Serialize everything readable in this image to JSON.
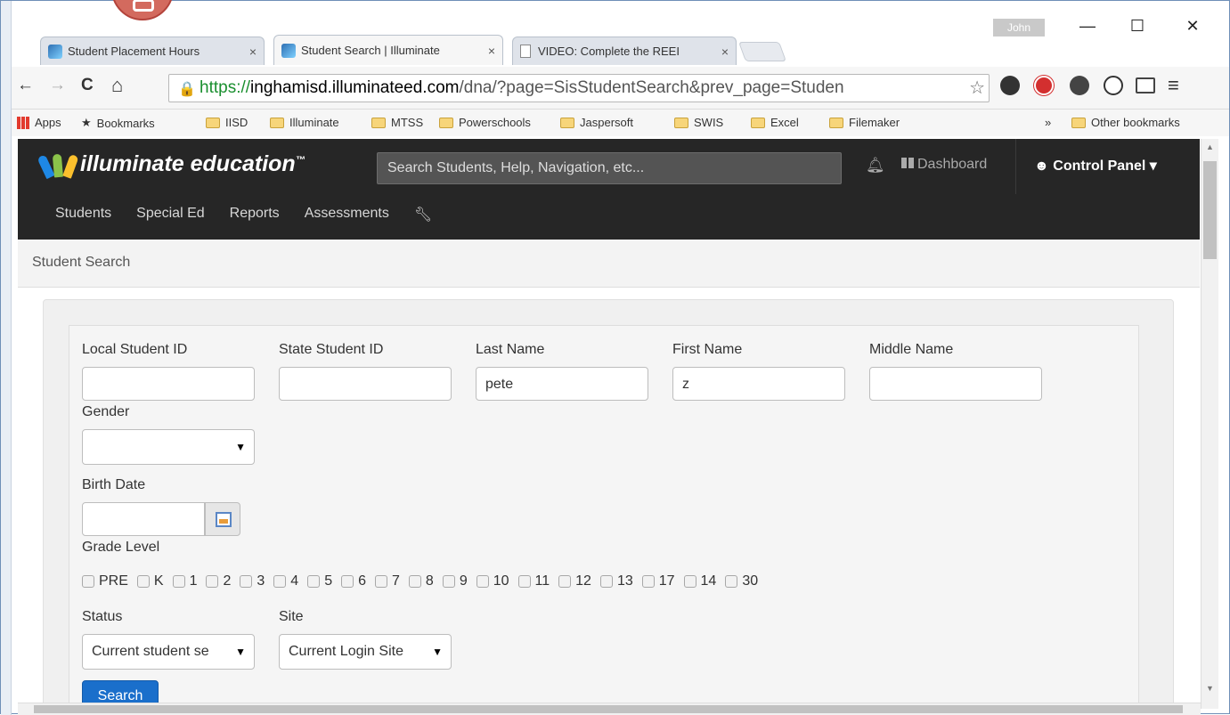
{
  "browser": {
    "user_badge": "John",
    "tabs": [
      {
        "title": "Student Placement Hours",
        "close": "×"
      },
      {
        "title": "Student Search | Illuminate",
        "close": "×"
      },
      {
        "title": "VIDEO: Complete the REEI",
        "close": "×"
      }
    ],
    "window_controls": {
      "minimize": "—",
      "maximize": "☐",
      "close": "✕"
    },
    "nav": {
      "back": "←",
      "forward": "→",
      "reload": "C",
      "home": "⌂"
    },
    "url": {
      "scheme": "https://",
      "host": "inghamisd.illuminateed.com",
      "path": "/dna/?page=SisStudentSearch&prev_page=Studen"
    },
    "bookmarks": {
      "apps": "Apps",
      "bookmarks": "Bookmarks",
      "folders": [
        "IISD",
        "Illuminate",
        "MTSS",
        "Powerschools",
        "Jaspersoft",
        "SWIS",
        "Excel",
        "Filemaker"
      ],
      "overflow": "»",
      "other": "Other bookmarks"
    }
  },
  "app": {
    "logo_text": "illuminate education",
    "logo_tm": "™",
    "search_placeholder": "Search Students, Help, Navigation, etc...",
    "dashboard": "Dashboard",
    "control_panel": "Control Panel",
    "nav": [
      "Students",
      "Special Ed",
      "Reports",
      "Assessments"
    ],
    "nav_tool_icon": "wrench-icon",
    "breadcrumb": "Student Search"
  },
  "form": {
    "fields": [
      {
        "label": "Local Student ID",
        "value": ""
      },
      {
        "label": "State Student ID",
        "value": ""
      },
      {
        "label": "Last Name",
        "value": "pete"
      },
      {
        "label": "First Name",
        "value": "z"
      },
      {
        "label": "Middle Name",
        "value": ""
      }
    ],
    "gender": {
      "label": "Gender",
      "value": ""
    },
    "birth_date": {
      "label": "Birth Date",
      "value": ""
    },
    "grade_level": {
      "label": "Grade Level",
      "grades": [
        "PRE",
        "K",
        "1",
        "2",
        "3",
        "4",
        "5",
        "6",
        "7",
        "8",
        "9",
        "10",
        "11",
        "12",
        "13",
        "17",
        "14",
        "30"
      ]
    },
    "status": {
      "label": "Status",
      "value": "Current student se"
    },
    "site": {
      "label": "Site",
      "value": "Current Login Site"
    },
    "search_button": "Search"
  },
  "colors": {
    "appbar": "#262626",
    "search_button": "#1a6fcb",
    "https_green": "#1a8f2f"
  }
}
